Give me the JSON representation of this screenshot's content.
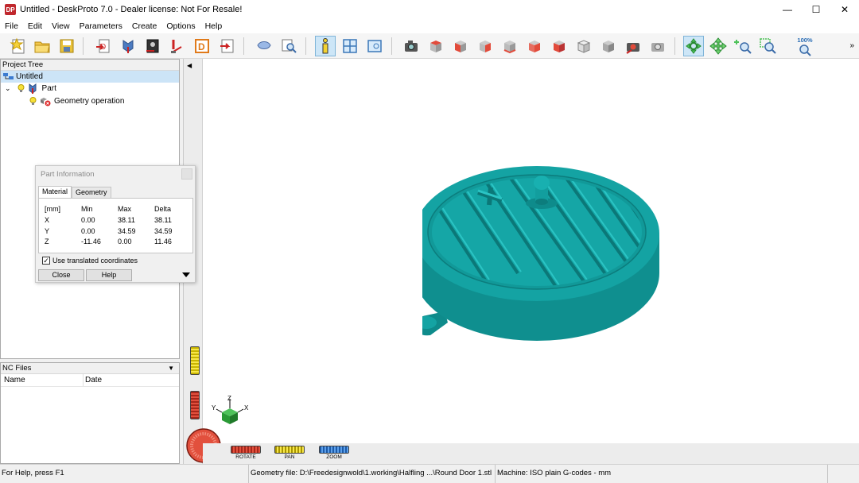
{
  "window": {
    "title": "Untitled - DeskProto 7.0 - Dealer license: Not For Resale!",
    "app_icon": "DP",
    "minimize": "—",
    "maximize": "☐",
    "close": "✕"
  },
  "menu": [
    "File",
    "Edit",
    "View",
    "Parameters",
    "Create",
    "Options",
    "Help"
  ],
  "toolbar": {
    "zoom_label": "100%",
    "more": "»"
  },
  "project_tree": {
    "header": "Project Tree",
    "root": "Untitled",
    "part": "Part",
    "operation": "Geometry operation"
  },
  "nc_files": {
    "header": "NC Files",
    "col_name": "Name",
    "col_date": "Date"
  },
  "part_info": {
    "title": "Part Information",
    "tabs": [
      "Material",
      "Geometry"
    ],
    "headers": [
      "[mm]",
      "Min",
      "Max",
      "Delta"
    ],
    "rows": [
      [
        "X",
        "0.00",
        "38.11",
        "38.11"
      ],
      [
        "Y",
        "0.00",
        "34.59",
        "34.59"
      ],
      [
        "Z",
        "-11.46",
        "0.00",
        "11.46"
      ]
    ],
    "checkbox_label": "Use translated coordinates",
    "checkbox_checked": true,
    "close_label": "Close",
    "help_label": "Help"
  },
  "viewport": {
    "axis_labels": {
      "z": "Z",
      "y": "Y",
      "x": "X"
    },
    "rotate_label": "ROTATE",
    "pan_label": "PAN",
    "zoom_label": "ZOOM",
    "model_color": "#14a3a3"
  },
  "status": {
    "help": "For Help, press F1",
    "geometry": "Geometry file: D:\\Freedesignwold\\1.working\\Halfling ...\\Round Door 1.stl",
    "machine": "Machine: ISO plain G-codes - mm"
  }
}
